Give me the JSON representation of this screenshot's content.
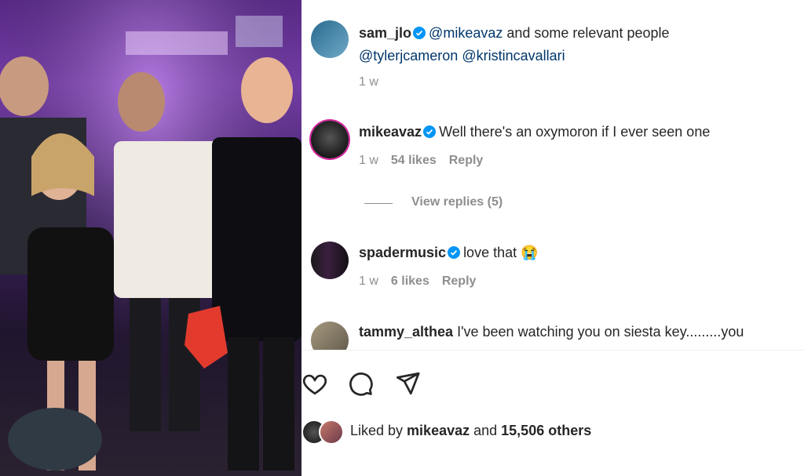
{
  "post": {
    "photo": "group-photo-nightclub"
  },
  "caption": {
    "username": "sam_jlo",
    "mention1": "@mikeavaz",
    "text": " and some relevant people",
    "mention2": "@tylerjcameron",
    "mention3": "@kristincavallari",
    "time": "1 w"
  },
  "comments": [
    {
      "username": "mikeavaz",
      "text": "Well there's an oxymoron if I ever seen one",
      "time": "1 w",
      "likes": "54 likes",
      "reply": "Reply",
      "view_replies": "View replies (5)"
    },
    {
      "username": "spadermusic",
      "text": "love that",
      "emoji": "😭",
      "time": "1 w",
      "likes": "6 likes",
      "reply": "Reply"
    },
    {
      "username": "tammy_althea",
      "text": "I've been watching you on siesta key.........you"
    }
  ],
  "actions": {
    "like_icon": "heart-icon",
    "comment_icon": "comment-icon",
    "share_icon": "share-icon"
  },
  "likes_summary": {
    "prefix": "Liked by ",
    "user": "mikeavaz",
    "middle": " and ",
    "count": "15,506 others"
  },
  "colors": {
    "verified": "#0095f6",
    "mention": "#00376b",
    "meta": "#8e8e8e"
  }
}
